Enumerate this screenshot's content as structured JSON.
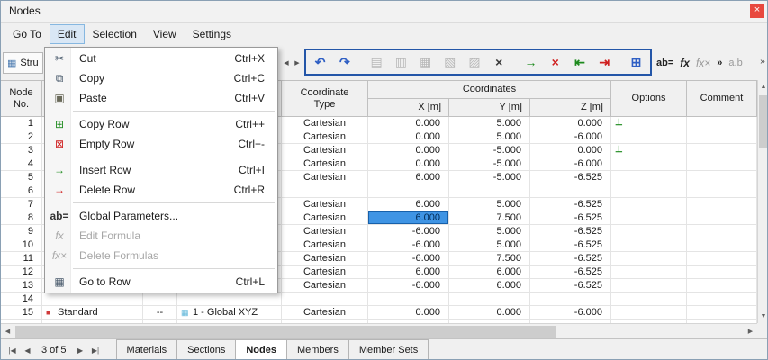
{
  "window": {
    "title": "Nodes",
    "close_glyph": "×"
  },
  "menubar": {
    "items": [
      {
        "label": "Go To"
      },
      {
        "label": "Edit",
        "open": true
      },
      {
        "label": "Selection"
      },
      {
        "label": "View"
      },
      {
        "label": "Settings"
      }
    ]
  },
  "edit_menu": {
    "items": [
      {
        "label": "Cut",
        "shortcut": "Ctrl+X",
        "icon": "scissors"
      },
      {
        "label": "Copy",
        "shortcut": "Ctrl+C",
        "icon": "copy"
      },
      {
        "label": "Paste",
        "shortcut": "Ctrl+V",
        "icon": "paste"
      },
      {
        "separator": true
      },
      {
        "label": "Copy Row",
        "shortcut": "Ctrl++",
        "icon": "copy-row"
      },
      {
        "label": "Empty Row",
        "shortcut": "Ctrl+-",
        "icon": "empty-row"
      },
      {
        "separator": true
      },
      {
        "label": "Insert Row",
        "shortcut": "Ctrl+I",
        "icon": "insert-row"
      },
      {
        "label": "Delete Row",
        "shortcut": "Ctrl+R",
        "icon": "delete-row"
      },
      {
        "separator": true
      },
      {
        "label": "Global Parameters...",
        "shortcut": "",
        "icon": "global-params"
      },
      {
        "label": "Edit Formula",
        "shortcut": "",
        "icon": "edit-formula",
        "disabled": true
      },
      {
        "label": "Delete Formulas",
        "shortcut": "",
        "icon": "delete-formulas",
        "disabled": true
      },
      {
        "separator": true
      },
      {
        "label": "Go to Row",
        "shortcut": "Ctrl+L",
        "icon": "goto-row"
      }
    ]
  },
  "icons": {
    "scissors": "✂",
    "copy": "⧉",
    "paste": "▣",
    "copy-row": "⊞",
    "empty-row": "⊠",
    "insert-row": "→",
    "delete-row": "→",
    "global-params": "ab=",
    "edit-formula": "fx",
    "delete-formulas": "fx×",
    "goto-row": "▦",
    "support": "⊥",
    "node-type": "■",
    "csys": "▦"
  },
  "toolbar": {
    "left_fragment": {
      "label": "Stru",
      "glyph": "▦"
    },
    "scroll_left_glyph": "◀",
    "scroll_right_glyph": "▶",
    "highlight_color": "#2456a8",
    "boxed_icons": [
      {
        "name": "select-previous-icon",
        "glyph": "↶",
        "color": "#2f5fc4"
      },
      {
        "name": "select-next-icon",
        "glyph": "↷",
        "color": "#2f5fc4"
      },
      {
        "name": "table-view-1-icon",
        "glyph": "▤",
        "color": "#9b9b9b",
        "disabled": true,
        "gap": true
      },
      {
        "name": "table-view-2-icon",
        "glyph": "▥",
        "color": "#9b9b9b",
        "disabled": true
      },
      {
        "name": "table-view-3-icon",
        "glyph": "▦",
        "color": "#9b9b9b",
        "disabled": true
      },
      {
        "name": "table-view-4-icon",
        "glyph": "▧",
        "color": "#9b9b9b",
        "disabled": true
      },
      {
        "name": "table-view-5-icon",
        "glyph": "▨",
        "color": "#9b9b9b",
        "disabled": true
      },
      {
        "name": "clear-table-icon",
        "glyph": "×",
        "color": "#3a3a3a"
      },
      {
        "name": "import-row-icon",
        "glyph": "→",
        "color": "#1d8a1d",
        "gap": true
      },
      {
        "name": "delete-row-icon",
        "glyph": "×",
        "color": "#cf2020"
      },
      {
        "name": "move-row-left-icon",
        "glyph": "⇤",
        "color": "#1d8a1d"
      },
      {
        "name": "move-row-right-icon",
        "glyph": "⇥",
        "color": "#cf2020"
      },
      {
        "name": "table-window-icon",
        "glyph": "⊞",
        "color": "#2f5fc4",
        "gap": true
      }
    ],
    "right_icons": [
      {
        "name": "global-parameters-icon",
        "glyph": "ab="
      },
      {
        "name": "edit-formula-icon",
        "glyph": "fx",
        "fx": true
      },
      {
        "name": "delete-formula-icon",
        "glyph": "fx×",
        "fx": true,
        "disabled": true
      },
      {
        "name": "overflow-chevron-icon",
        "glyph": "»"
      },
      {
        "name": "decimals-icon",
        "glyph": "a.b",
        "disabled": true
      }
    ],
    "overflow_glyph": "»"
  },
  "table": {
    "header": {
      "node_no": [
        "Node",
        "No."
      ],
      "coordinate_type": [
        "Coordinate",
        "Type"
      ],
      "coordinates_group": "Coordinates",
      "x": "X [m]",
      "y": "Y [m]",
      "z": "Z [m]",
      "options": "Options",
      "comment": "Comment"
    },
    "selected": {
      "row_no": "8",
      "column": "x"
    },
    "rows": [
      {
        "no": "1",
        "type": "",
        "ref": "",
        "csys": "",
        "ctype": "Cartesian",
        "x": "0.000",
        "y": "5.000",
        "z": "0.000",
        "options_icon": true,
        "comment": ""
      },
      {
        "no": "2",
        "type": "",
        "ref": "",
        "csys": "",
        "ctype": "Cartesian",
        "x": "0.000",
        "y": "5.000",
        "z": "-6.000",
        "options_icon": false,
        "comment": ""
      },
      {
        "no": "3",
        "type": "",
        "ref": "",
        "csys": "",
        "ctype": "Cartesian",
        "x": "0.000",
        "y": "-5.000",
        "z": "0.000",
        "options_icon": true,
        "comment": ""
      },
      {
        "no": "4",
        "type": "",
        "ref": "",
        "csys": "",
        "ctype": "Cartesian",
        "x": "0.000",
        "y": "-5.000",
        "z": "-6.000",
        "options_icon": false,
        "comment": ""
      },
      {
        "no": "5",
        "type": "",
        "ref": "",
        "csys": "",
        "ctype": "Cartesian",
        "x": "6.000",
        "y": "-5.000",
        "z": "-6.525",
        "options_icon": false,
        "comment": ""
      },
      {
        "no": "6",
        "type": "",
        "ref": "",
        "csys": "",
        "ctype": "",
        "x": "",
        "y": "",
        "z": "",
        "options_icon": false,
        "comment": ""
      },
      {
        "no": "7",
        "type": "",
        "ref": "",
        "csys": "",
        "ctype": "Cartesian",
        "x": "6.000",
        "y": "5.000",
        "z": "-6.525",
        "options_icon": false,
        "comment": ""
      },
      {
        "no": "8",
        "type": "",
        "ref": "",
        "csys": "",
        "ctype": "Cartesian",
        "x": "6.000",
        "y": "7.500",
        "z": "-6.525",
        "options_icon": false,
        "comment": ""
      },
      {
        "no": "9",
        "type": "",
        "ref": "",
        "csys": "",
        "ctype": "Cartesian",
        "x": "-6.000",
        "y": "5.000",
        "z": "-6.525",
        "options_icon": false,
        "comment": ""
      },
      {
        "no": "10",
        "type": "",
        "ref": "",
        "csys": "",
        "ctype": "Cartesian",
        "x": "-6.000",
        "y": "5.000",
        "z": "-6.525",
        "options_icon": false,
        "comment": ""
      },
      {
        "no": "11",
        "type": "",
        "ref": "",
        "csys": "",
        "ctype": "Cartesian",
        "x": "-6.000",
        "y": "7.500",
        "z": "-6.525",
        "options_icon": false,
        "comment": ""
      },
      {
        "no": "12",
        "type": "",
        "ref": "",
        "csys": "",
        "ctype": "Cartesian",
        "x": "6.000",
        "y": "6.000",
        "z": "-6.525",
        "options_icon": false,
        "comment": ""
      },
      {
        "no": "13",
        "type": "",
        "ref": "",
        "csys": "",
        "ctype": "Cartesian",
        "x": "-6.000",
        "y": "6.000",
        "z": "-6.525",
        "options_icon": false,
        "comment": ""
      },
      {
        "no": "14",
        "type": "",
        "ref": "",
        "csys": "",
        "ctype": "",
        "x": "",
        "y": "",
        "z": "",
        "options_icon": false,
        "comment": ""
      },
      {
        "no": "15",
        "type": "Standard",
        "ref": "--",
        "csys": "1 - Global XYZ",
        "ctype": "Cartesian",
        "x": "0.000",
        "y": "0.000",
        "z": "-6.000",
        "options_icon": false,
        "comment": ""
      },
      {
        "no": "",
        "type": "",
        "ref": "",
        "csys": "",
        "ctype": "",
        "x": "",
        "y": "",
        "z": "",
        "options_icon": false,
        "comment": ""
      }
    ]
  },
  "footer": {
    "nav_label": "3 of 5",
    "nav_first": "|◀",
    "nav_prev": "◀",
    "nav_next": "▶",
    "nav_last": "▶|",
    "tabs": [
      {
        "label": "Materials"
      },
      {
        "label": "Sections"
      },
      {
        "label": "Nodes",
        "active": true
      },
      {
        "label": "Members"
      },
      {
        "label": "Member Sets"
      }
    ]
  },
  "scroll": {
    "up": "▲",
    "down": "▼",
    "left": "◀",
    "right": "▶"
  }
}
